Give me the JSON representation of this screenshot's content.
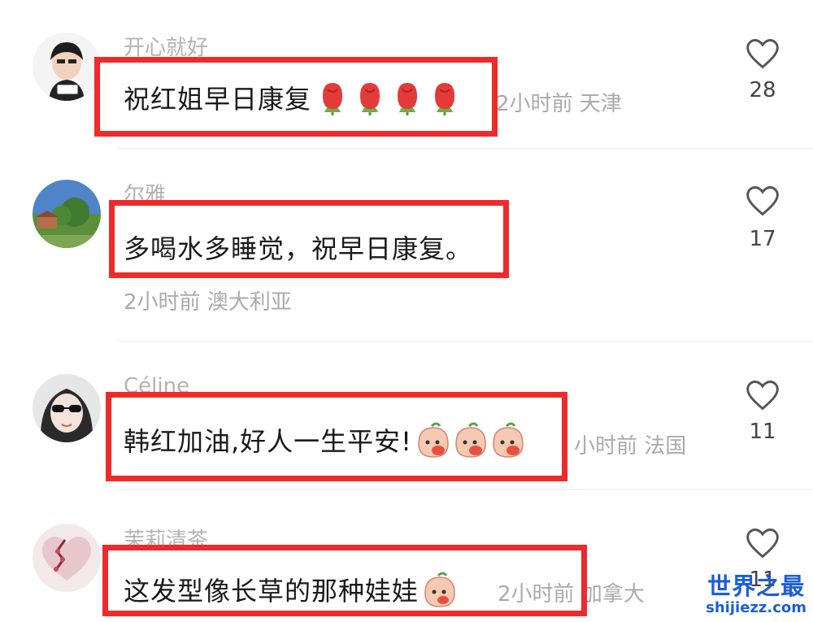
{
  "comments": [
    {
      "username": "开心就好",
      "text": "祝红姐早日康复",
      "emoji": "rose-emoji",
      "emoji_count": 4,
      "time": "2小时前",
      "location": "天津",
      "likes": "28"
    },
    {
      "username": "尔雅",
      "text": "多喝水多睡觉，祝早日康复。",
      "time": "2小时前",
      "location": "澳大利亚",
      "likes": "17"
    },
    {
      "username": "Céline",
      "text": "韩红加油,好人一生平安!",
      "emoji": "peach-face-emoji",
      "emoji_count": 3,
      "time": "小时前",
      "location": "法国",
      "likes": "11"
    },
    {
      "username": "茉莉清茶",
      "text": "这发型像长草的那种娃娃",
      "emoji": "peach-face-emoji",
      "emoji_count": 1,
      "time": "2小时前",
      "location": "加拿大",
      "likes": "11"
    }
  ],
  "icons": {
    "like": "heart-outline-icon"
  },
  "colors": {
    "highlight": "#ee2a2a",
    "watermark": "#1b5ed8",
    "meta": "#aaaaaa"
  },
  "watermark": {
    "title": "世界之最",
    "url": "shijiezz.com"
  }
}
